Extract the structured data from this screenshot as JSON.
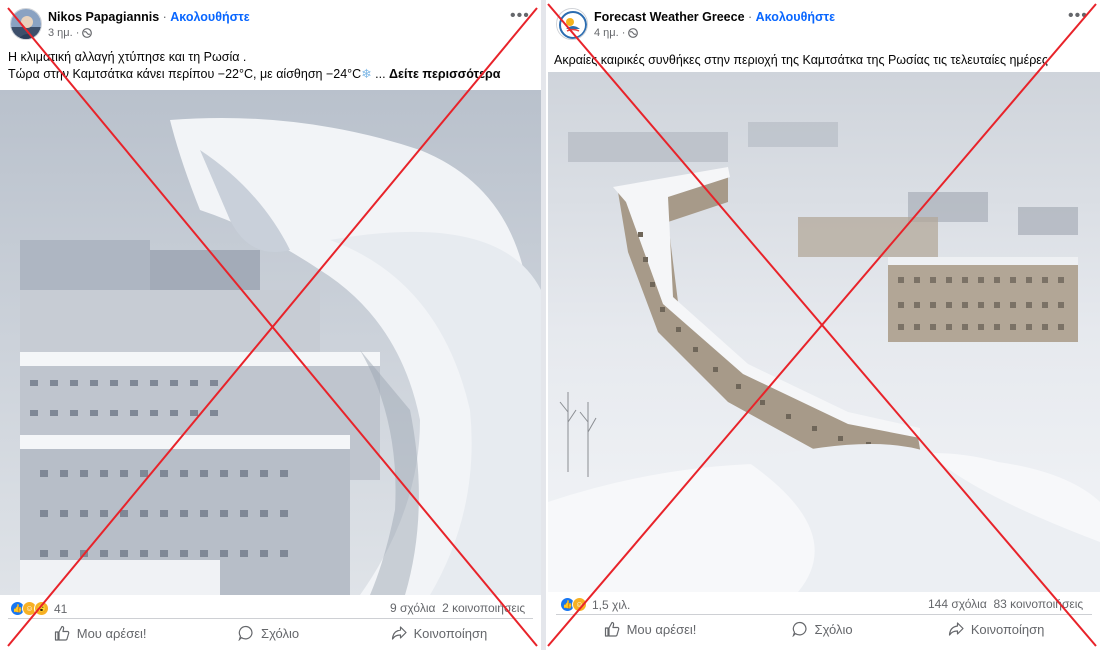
{
  "colors": {
    "accent": "#0866ff",
    "cross": "#e8232a",
    "muted": "#65676b"
  },
  "posts": [
    {
      "author": "Nikos Papagiannis",
      "separator": " · ",
      "follow": "Ακολουθήστε",
      "time": "3 ημ. ·",
      "caption_line1": "Η κλιματική αλλαγή χτύπησε και τη Ρωσία .",
      "caption_line2": "Τώρα στην Καμτσάτκα κάνει περίπου −22°C, με αίσθηση −24°C",
      "caption_tail": " ... ",
      "see_more": "Δείτε περισσότερα",
      "reaction_count": "41",
      "comments": "9 σχόλια",
      "shares": "2 κοινοποιήσεις",
      "actions": {
        "like": "Μου αρέσει!",
        "comment": "Σχόλιο",
        "share": "Κοινοποίηση"
      }
    },
    {
      "author": "Forecast Weather Greece",
      "separator": " · ",
      "follow": "Ακολουθήστε",
      "time": "4 ημ. ·",
      "caption_line1": "Ακραίες καιρικές συνθήκες  στην περιοχή της Καμτσάτκα της Ρωσίας τις τελευταίες ημέρες",
      "reaction_count": "1,5 χιλ.",
      "comments": "144 σχόλια",
      "shares": "83 κοινοποιήσεις",
      "actions": {
        "like": "Μου αρέσει!",
        "comment": "Σχόλιο",
        "share": "Κοινοποίηση"
      }
    }
  ],
  "icons": [
    "more-options-icon",
    "globe-icon",
    "like-icon",
    "comment-icon",
    "share-icon",
    "like-reaction-icon",
    "care-reaction-icon",
    "wow-reaction-icon",
    "snowstorm-photo",
    "red-cross-overlay"
  ]
}
